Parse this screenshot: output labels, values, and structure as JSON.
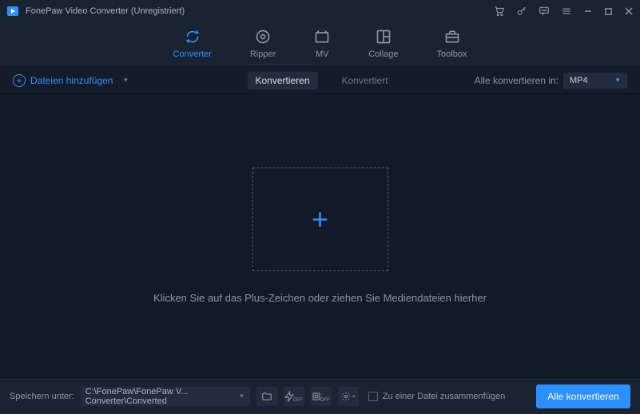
{
  "title": "FonePaw Video Converter (Unregistriert)",
  "nav": {
    "converter": "Converter",
    "ripper": "Ripper",
    "mv": "MV",
    "collage": "Collage",
    "toolbox": "Toolbox"
  },
  "subbar": {
    "add_files": "Dateien hinzufügen",
    "tab_convert": "Konvertieren",
    "tab_converted": "Konvertiert",
    "convert_all_label": "Alle konvertieren in:",
    "format": "MP4"
  },
  "main": {
    "hint": "Klicken Sie auf das Plus-Zeichen oder ziehen Sie Mediendateien hierher"
  },
  "bottom": {
    "save_label": "Speichern unter:",
    "path": "C:\\FonePaw\\FonePaw V... Converter\\Converted",
    "merge_label": "Zu einer Datei zusammenfügen",
    "convert_button": "Alle konvertieren"
  }
}
